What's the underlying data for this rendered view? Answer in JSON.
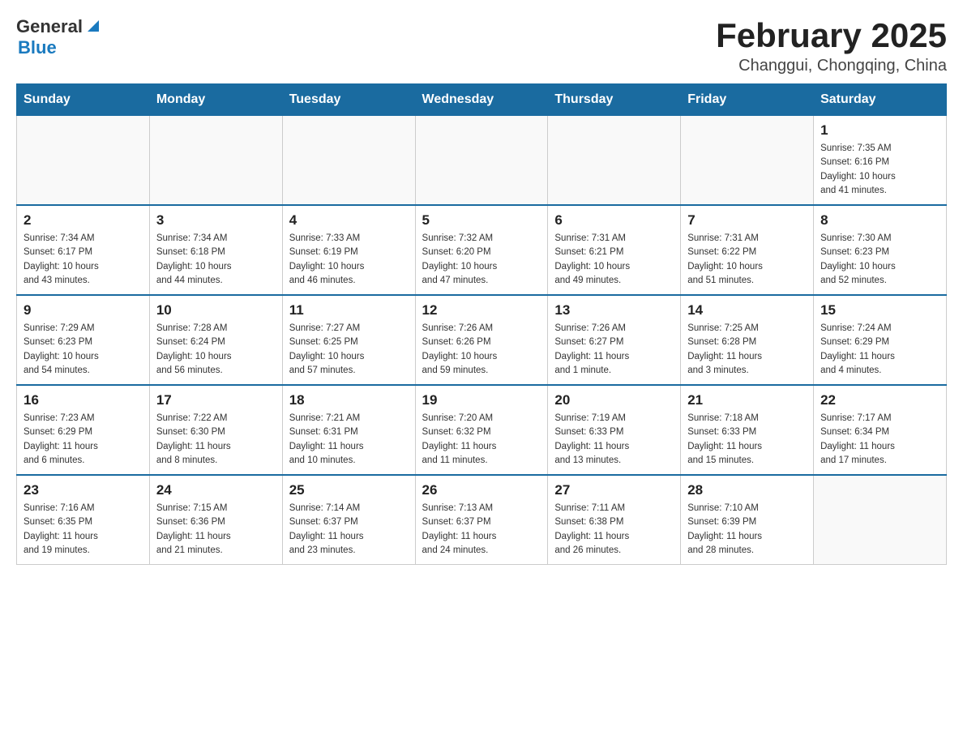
{
  "header": {
    "logo": {
      "general": "General",
      "blue": "Blue",
      "arrow_unicode": "▶"
    },
    "title": "February 2025",
    "location": "Changgui, Chongqing, China"
  },
  "days_of_week": [
    "Sunday",
    "Monday",
    "Tuesday",
    "Wednesday",
    "Thursday",
    "Friday",
    "Saturday"
  ],
  "weeks": [
    {
      "days": [
        {
          "num": "",
          "info": ""
        },
        {
          "num": "",
          "info": ""
        },
        {
          "num": "",
          "info": ""
        },
        {
          "num": "",
          "info": ""
        },
        {
          "num": "",
          "info": ""
        },
        {
          "num": "",
          "info": ""
        },
        {
          "num": "1",
          "info": "Sunrise: 7:35 AM\nSunset: 6:16 PM\nDaylight: 10 hours\nand 41 minutes."
        }
      ]
    },
    {
      "days": [
        {
          "num": "2",
          "info": "Sunrise: 7:34 AM\nSunset: 6:17 PM\nDaylight: 10 hours\nand 43 minutes."
        },
        {
          "num": "3",
          "info": "Sunrise: 7:34 AM\nSunset: 6:18 PM\nDaylight: 10 hours\nand 44 minutes."
        },
        {
          "num": "4",
          "info": "Sunrise: 7:33 AM\nSunset: 6:19 PM\nDaylight: 10 hours\nand 46 minutes."
        },
        {
          "num": "5",
          "info": "Sunrise: 7:32 AM\nSunset: 6:20 PM\nDaylight: 10 hours\nand 47 minutes."
        },
        {
          "num": "6",
          "info": "Sunrise: 7:31 AM\nSunset: 6:21 PM\nDaylight: 10 hours\nand 49 minutes."
        },
        {
          "num": "7",
          "info": "Sunrise: 7:31 AM\nSunset: 6:22 PM\nDaylight: 10 hours\nand 51 minutes."
        },
        {
          "num": "8",
          "info": "Sunrise: 7:30 AM\nSunset: 6:23 PM\nDaylight: 10 hours\nand 52 minutes."
        }
      ]
    },
    {
      "days": [
        {
          "num": "9",
          "info": "Sunrise: 7:29 AM\nSunset: 6:23 PM\nDaylight: 10 hours\nand 54 minutes."
        },
        {
          "num": "10",
          "info": "Sunrise: 7:28 AM\nSunset: 6:24 PM\nDaylight: 10 hours\nand 56 minutes."
        },
        {
          "num": "11",
          "info": "Sunrise: 7:27 AM\nSunset: 6:25 PM\nDaylight: 10 hours\nand 57 minutes."
        },
        {
          "num": "12",
          "info": "Sunrise: 7:26 AM\nSunset: 6:26 PM\nDaylight: 10 hours\nand 59 minutes."
        },
        {
          "num": "13",
          "info": "Sunrise: 7:26 AM\nSunset: 6:27 PM\nDaylight: 11 hours\nand 1 minute."
        },
        {
          "num": "14",
          "info": "Sunrise: 7:25 AM\nSunset: 6:28 PM\nDaylight: 11 hours\nand 3 minutes."
        },
        {
          "num": "15",
          "info": "Sunrise: 7:24 AM\nSunset: 6:29 PM\nDaylight: 11 hours\nand 4 minutes."
        }
      ]
    },
    {
      "days": [
        {
          "num": "16",
          "info": "Sunrise: 7:23 AM\nSunset: 6:29 PM\nDaylight: 11 hours\nand 6 minutes."
        },
        {
          "num": "17",
          "info": "Sunrise: 7:22 AM\nSunset: 6:30 PM\nDaylight: 11 hours\nand 8 minutes."
        },
        {
          "num": "18",
          "info": "Sunrise: 7:21 AM\nSunset: 6:31 PM\nDaylight: 11 hours\nand 10 minutes."
        },
        {
          "num": "19",
          "info": "Sunrise: 7:20 AM\nSunset: 6:32 PM\nDaylight: 11 hours\nand 11 minutes."
        },
        {
          "num": "20",
          "info": "Sunrise: 7:19 AM\nSunset: 6:33 PM\nDaylight: 11 hours\nand 13 minutes."
        },
        {
          "num": "21",
          "info": "Sunrise: 7:18 AM\nSunset: 6:33 PM\nDaylight: 11 hours\nand 15 minutes."
        },
        {
          "num": "22",
          "info": "Sunrise: 7:17 AM\nSunset: 6:34 PM\nDaylight: 11 hours\nand 17 minutes."
        }
      ]
    },
    {
      "days": [
        {
          "num": "23",
          "info": "Sunrise: 7:16 AM\nSunset: 6:35 PM\nDaylight: 11 hours\nand 19 minutes."
        },
        {
          "num": "24",
          "info": "Sunrise: 7:15 AM\nSunset: 6:36 PM\nDaylight: 11 hours\nand 21 minutes."
        },
        {
          "num": "25",
          "info": "Sunrise: 7:14 AM\nSunset: 6:37 PM\nDaylight: 11 hours\nand 23 minutes."
        },
        {
          "num": "26",
          "info": "Sunrise: 7:13 AM\nSunset: 6:37 PM\nDaylight: 11 hours\nand 24 minutes."
        },
        {
          "num": "27",
          "info": "Sunrise: 7:11 AM\nSunset: 6:38 PM\nDaylight: 11 hours\nand 26 minutes."
        },
        {
          "num": "28",
          "info": "Sunrise: 7:10 AM\nSunset: 6:39 PM\nDaylight: 11 hours\nand 28 minutes."
        },
        {
          "num": "",
          "info": ""
        }
      ]
    }
  ]
}
